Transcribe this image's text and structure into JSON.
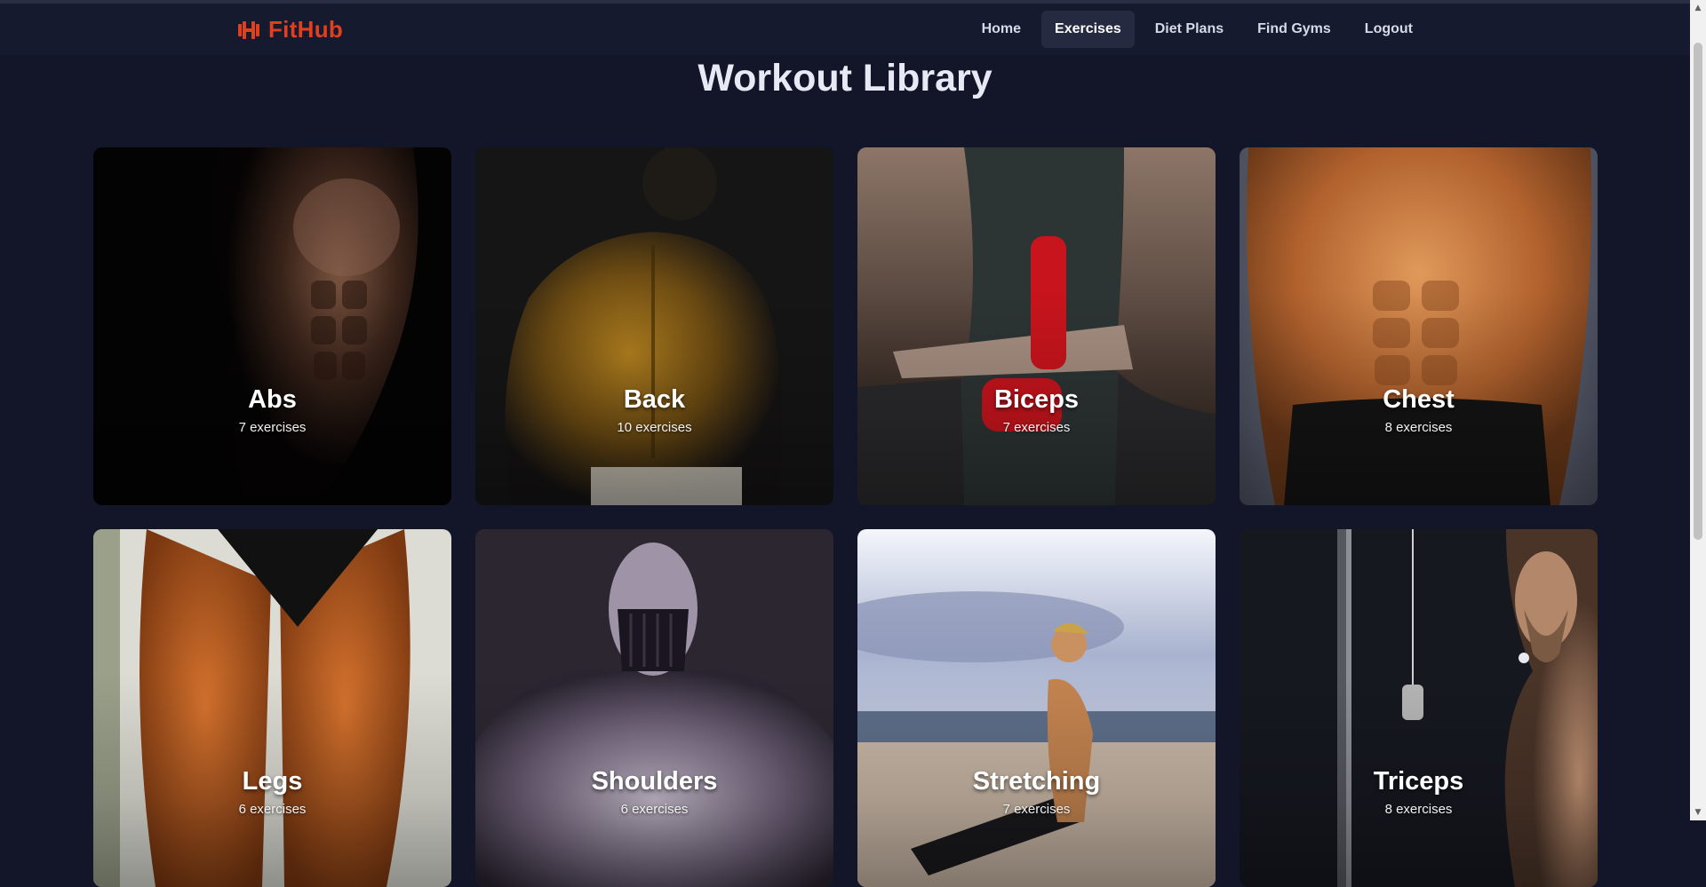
{
  "brand": {
    "name": "FitHub",
    "icon": "dumbbell-icon",
    "color": "#e0401e"
  },
  "nav": {
    "items": [
      {
        "label": "Home",
        "active": false
      },
      {
        "label": "Exercises",
        "active": true
      },
      {
        "label": "Diet Plans",
        "active": false
      },
      {
        "label": "Find Gyms",
        "active": false
      },
      {
        "label": "Logout",
        "active": false
      }
    ]
  },
  "page": {
    "title": "Workout Library"
  },
  "categories": [
    {
      "name": "Abs",
      "count": "7 exercises"
    },
    {
      "name": "Back",
      "count": "10 exercises"
    },
    {
      "name": "Biceps",
      "count": "7 exercises"
    },
    {
      "name": "Chest",
      "count": "8 exercises"
    },
    {
      "name": "Legs",
      "count": "6 exercises"
    },
    {
      "name": "Shoulders",
      "count": "6 exercises"
    },
    {
      "name": "Stretching",
      "count": "7 exercises"
    },
    {
      "name": "Triceps",
      "count": "8 exercises"
    }
  ],
  "theme": {
    "background": "#131528",
    "navbar": "#161a2e",
    "active_tab": "#262a40"
  }
}
